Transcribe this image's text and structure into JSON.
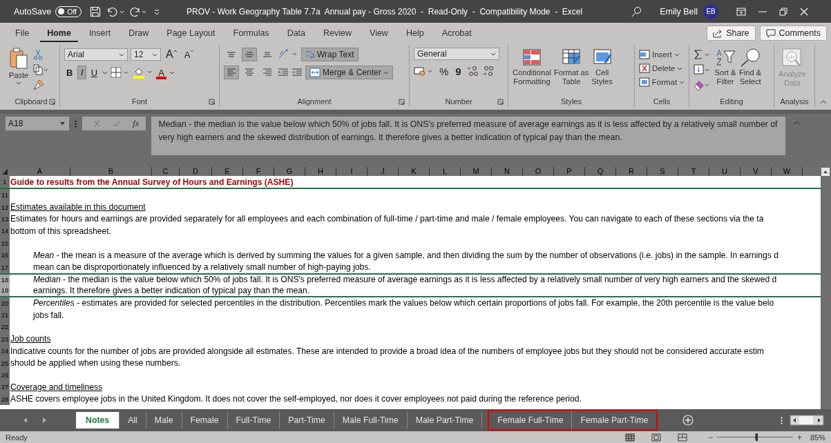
{
  "title_bar": {
    "autosave_label": "AutoSave",
    "autosave_toggle": {
      "label": "Off",
      "on": false
    },
    "title": "PROV - Work Geography Table 7.7a  Annual pay - Gross 2020  -  Read-Only  -  Compatibility Mode  -  Excel",
    "user_name": "Emily Bell",
    "user_initials": "EB"
  },
  "ribbon_tabs": [
    {
      "label": "File",
      "selected": false
    },
    {
      "label": "Home",
      "selected": true
    },
    {
      "label": "Insert",
      "selected": false
    },
    {
      "label": "Draw",
      "selected": false
    },
    {
      "label": "Page Layout",
      "selected": false
    },
    {
      "label": "Formulas",
      "selected": false
    },
    {
      "label": "Data",
      "selected": false
    },
    {
      "label": "Review",
      "selected": false
    },
    {
      "label": "View",
      "selected": false
    },
    {
      "label": "Help",
      "selected": false
    },
    {
      "label": "Acrobat",
      "selected": false
    }
  ],
  "share_button": "Share",
  "comments_button": "Comments",
  "ribbon": {
    "clipboard": {
      "paste": "Paste",
      "label": "Clipboard"
    },
    "font": {
      "family": "Arial",
      "size": "12",
      "grow": "A",
      "shrink": "A",
      "color_letter": "A",
      "label": "Font",
      "format_buttons": [
        {
          "label": "B",
          "kind": "bold",
          "on": false
        },
        {
          "label": "I",
          "kind": "italic",
          "on": true
        },
        {
          "label": "U",
          "kind": "underline",
          "on": false
        }
      ]
    },
    "alignment": {
      "label": "Alignment",
      "wrap_text": {
        "label": "Wrap Text",
        "on": true
      },
      "merge": {
        "label": "Merge & Center",
        "on": true
      },
      "vertical": [
        {
          "kind": "top",
          "on": false
        },
        {
          "kind": "middle",
          "on": true
        },
        {
          "kind": "bottom",
          "on": false
        }
      ],
      "horizontal": [
        {
          "kind": "left",
          "on": true
        },
        {
          "kind": "center",
          "on": false
        },
        {
          "kind": "right",
          "on": false
        }
      ]
    },
    "number": {
      "format": "General",
      "percent": "%",
      "comma": "9",
      "label": "Number"
    },
    "styles": {
      "label": "Styles",
      "buttons": [
        {
          "kind": "conditional",
          "lines": [
            "Conditional",
            "Formatting"
          ]
        },
        {
          "kind": "table",
          "lines": [
            "Format as",
            "Table"
          ]
        },
        {
          "kind": "cellstyles",
          "lines": [
            "Cell",
            "Styles"
          ]
        }
      ]
    },
    "cells": {
      "label": "Cells",
      "buttons": [
        {
          "kind": "insert",
          "label": "Insert"
        },
        {
          "kind": "delete",
          "label": "Delete"
        },
        {
          "kind": "format",
          "label": "Format"
        }
      ]
    },
    "editing": {
      "label": "Editing",
      "buttons": [
        {
          "kind": "sort",
          "lines": [
            "Sort &",
            "Filter"
          ]
        },
        {
          "kind": "find",
          "lines": [
            "Find &",
            "Select"
          ]
        }
      ]
    },
    "analysis": {
      "label": "Analysis",
      "button": {
        "lines": [
          "Analyze",
          "Data"
        ],
        "disabled": true
      }
    }
  },
  "formula_bar": {
    "name_box": "A18",
    "function_label": "fx",
    "formula": "Median - the median is the value below which 50% of jobs fall. It is ONS's preferred measure of average earnings as it is less affected by a relatively small number of very high earners and the skewed distribution of earnings. It therefore gives a better indication of typical pay than the mean."
  },
  "columns": [
    "A",
    "B",
    "C",
    "D",
    "E",
    "F",
    "G",
    "H",
    "I",
    "J",
    "K",
    "L",
    "M",
    "N",
    "O",
    "P",
    "Q",
    "R",
    "S",
    "T",
    "U",
    "V",
    "W"
  ],
  "rows": [
    {
      "number": "1",
      "kind": "title",
      "text": "Guide to results from the Annual Survey of Hours and Earnings (ASHE)",
      "selected": false
    },
    {
      "number": "11",
      "kind": "body",
      "selected": false
    },
    {
      "number": "12",
      "kind": "heading",
      "text": "Estimates available in this document",
      "selected": false
    },
    {
      "number": "13",
      "kind": "body",
      "text": "Estimates for hours and earnings are provided separately for all employees and each combination of full-time / part-time and male / female employees. You can navigate to each of these sections via the ta",
      "selected": false
    },
    {
      "number": "14",
      "kind": "body",
      "text": "bottom of this spreadsheet.",
      "selected": false
    },
    {
      "number": "15",
      "kind": "body",
      "selected": false
    },
    {
      "number": "16",
      "kind": "indent",
      "text": "*Mean*  - the mean is a measure of the average which is derived by summing the values for a given sample, and then dividing the sum by the number of observations (i.e. jobs) in the sample. In earnings d",
      "selected": false
    },
    {
      "number": "17",
      "kind": "indent",
      "text": "mean can be disproportionately influenced by a relatively small number of high-paying jobs.",
      "selected": false
    },
    {
      "number": "18",
      "kind": "indent",
      "text": "*Median*  - the median is the value below which 50% of jobs fall. It is ONS's preferred measure of average earnings as it is less affected by a relatively small number of very high earners and the skewed d",
      "selected": true
    },
    {
      "number": "19",
      "kind": "indent",
      "text": "earnings. It therefore gives a better indication of typical pay than the mean.",
      "selected": true
    },
    {
      "number": "20",
      "kind": "indent",
      "text": "*Percentiles*  - estimates are provided for selected percentiles in the distribution. Percentiles mark the values below which certain proportions of jobs fall. For example, the 20th percentile is the value belo",
      "selected": false
    },
    {
      "number": "21",
      "kind": "indent",
      "text": "jobs fall.",
      "selected": false
    },
    {
      "number": "22",
      "kind": "body",
      "selected": false
    },
    {
      "number": "23",
      "kind": "heading",
      "text": "Job counts",
      "selected": false
    },
    {
      "number": "24",
      "kind": "body",
      "text": "Indicative counts for the number of jobs are provided alongside all estimates. These are intended to provide a broad idea of the numbers of employee jobs but they should not be considered accurate estim",
      "selected": false
    },
    {
      "number": "25",
      "kind": "body",
      "text": "should be applied when using these numbers.",
      "selected": false
    },
    {
      "number": "26",
      "kind": "body",
      "selected": false
    },
    {
      "number": "27",
      "kind": "heading",
      "text": "Coverage and timeliness",
      "selected": false
    },
    {
      "number": "28",
      "kind": "body",
      "text": "ASHE covers employee jobs in the United Kingdom. It does not cover the self-employed, nor does it cover employees not paid during the reference period.",
      "selected": false
    }
  ],
  "sheet_tabs": [
    {
      "label": "Notes",
      "selected": true,
      "highlighted": false
    },
    {
      "label": "All",
      "selected": false,
      "highlighted": false
    },
    {
      "label": "Male",
      "selected": false,
      "highlighted": false
    },
    {
      "label": "Female",
      "selected": false,
      "highlighted": false
    },
    {
      "label": "Full-Time",
      "selected": false,
      "highlighted": false
    },
    {
      "label": "Part-Time",
      "selected": false,
      "highlighted": false
    },
    {
      "label": "Male Full-Time",
      "selected": false,
      "highlighted": false
    },
    {
      "label": "Male Part-Time",
      "selected": false,
      "highlighted": false
    },
    {
      "label": "Female Full-Time",
      "selected": false,
      "highlighted": true
    },
    {
      "label": "Female Part-Time",
      "selected": false,
      "highlighted": true
    }
  ],
  "status_bar": {
    "status": "Ready",
    "zoom_out": "−",
    "zoom_in": "+",
    "zoom": {
      "level": 0.52,
      "reading": "85%"
    }
  }
}
